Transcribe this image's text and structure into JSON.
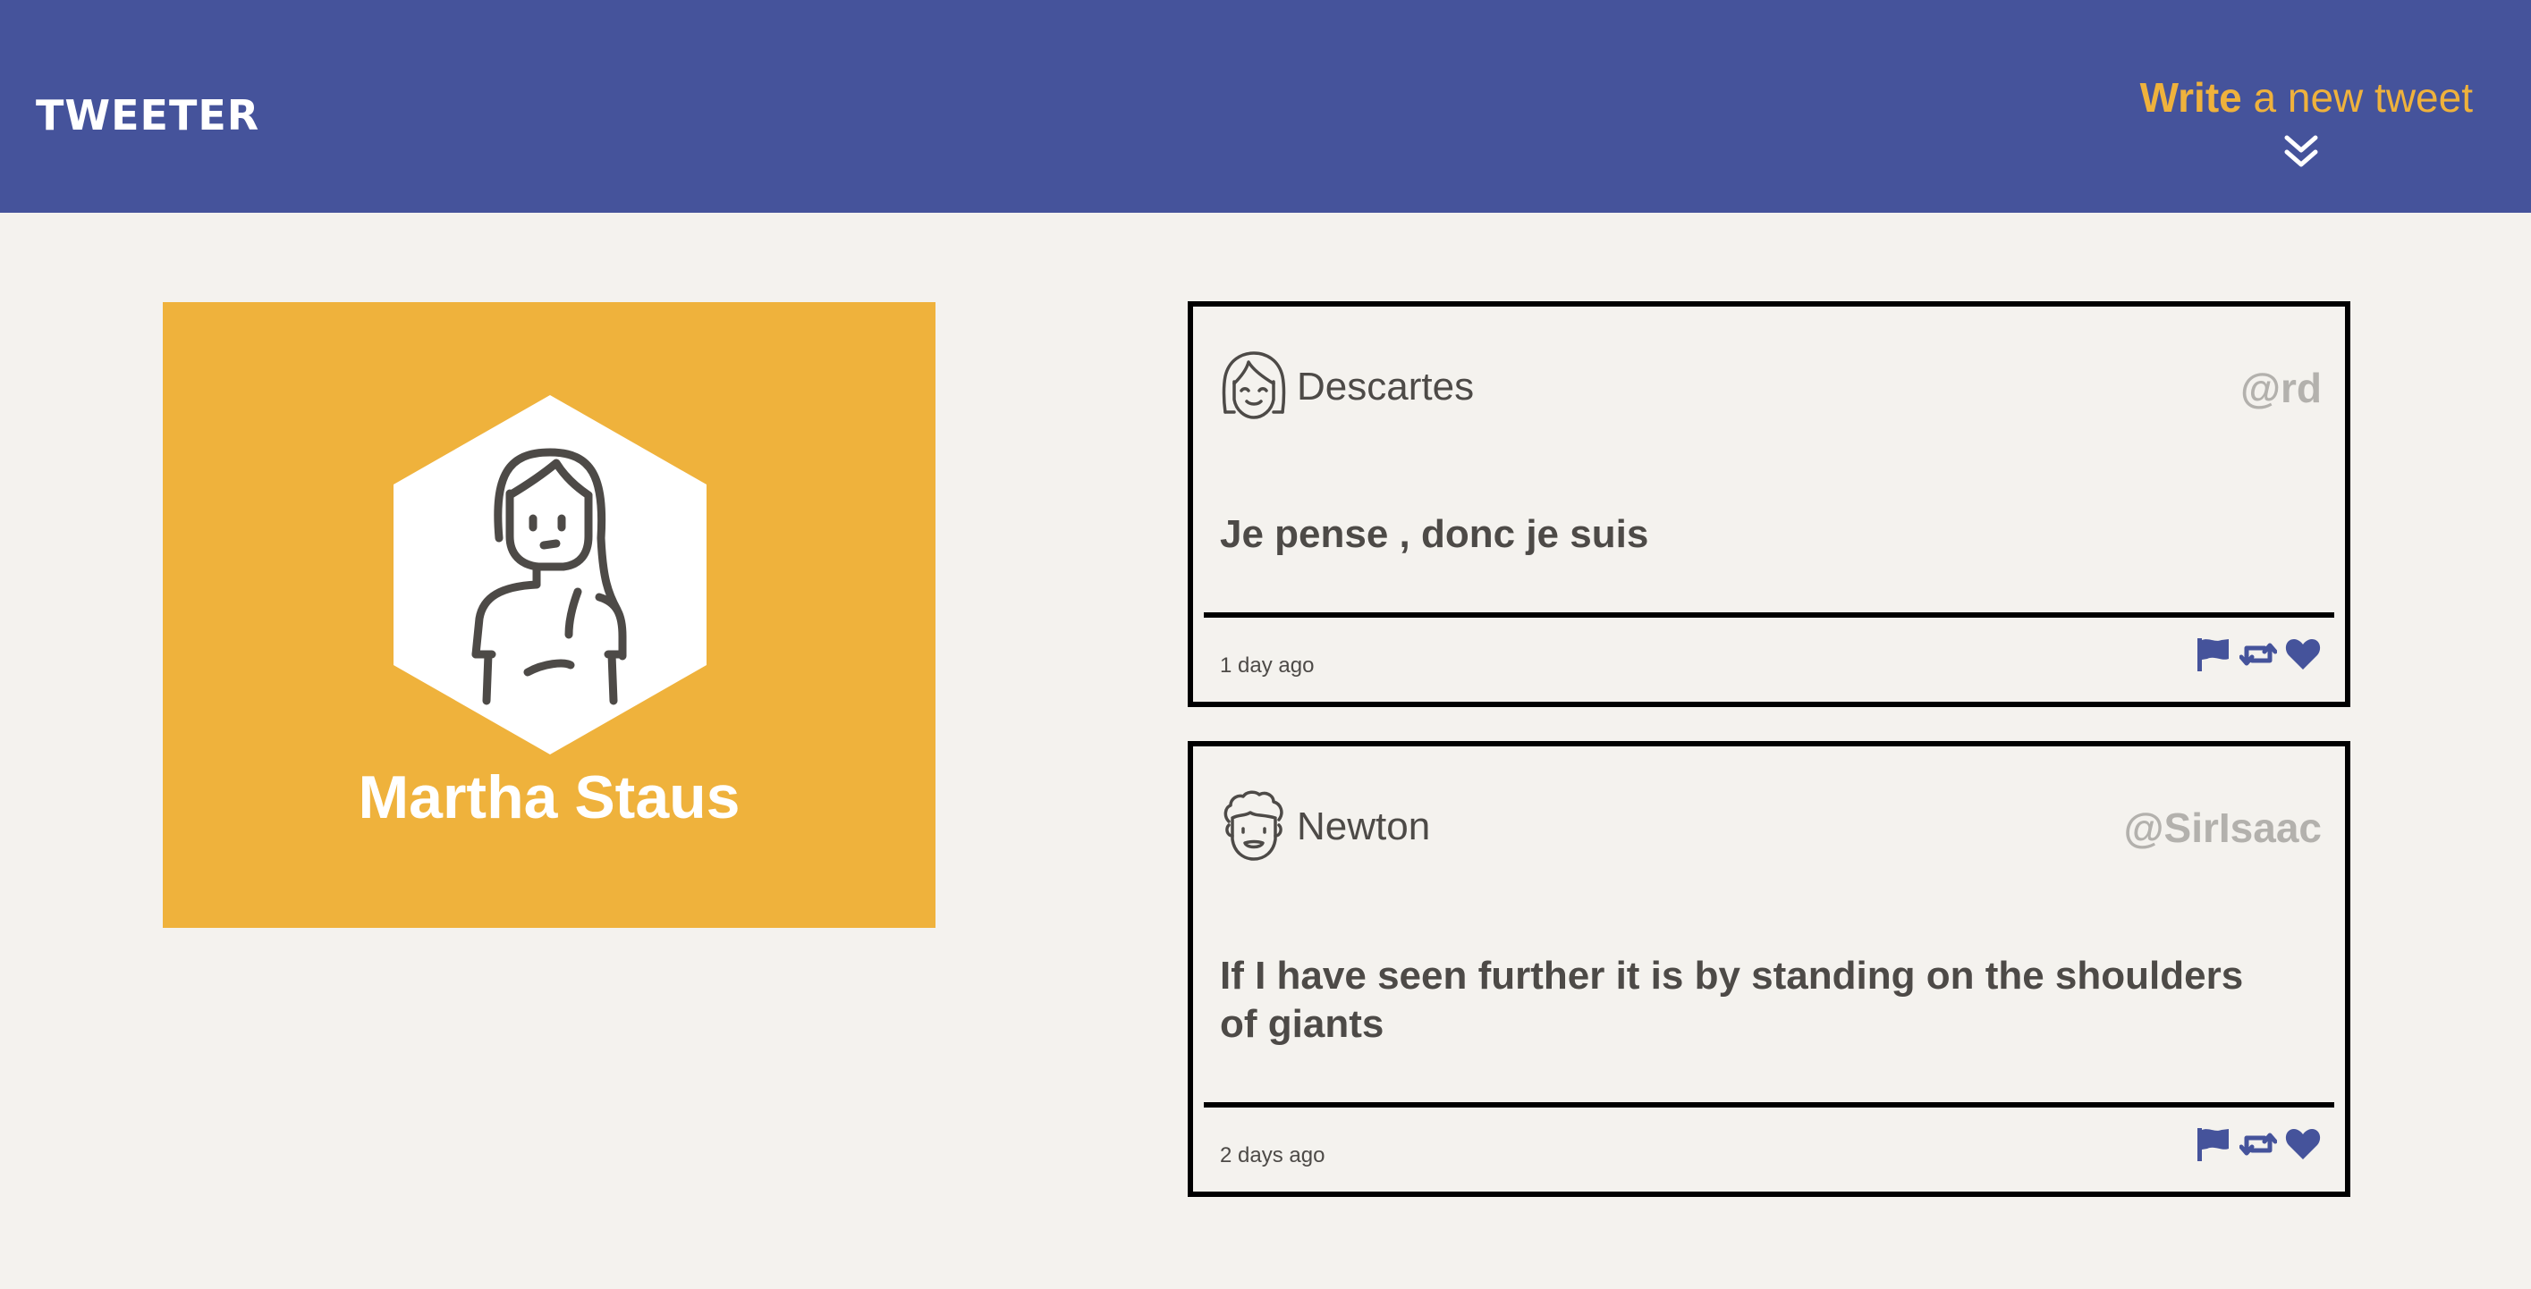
{
  "nav": {
    "brand": "TWEETER",
    "compose_bold": "Write",
    "compose_rest": " a new tweet",
    "compose_icon": "double-chevron-down-icon"
  },
  "profile": {
    "name": "Martha Staus",
    "avatar_icon": "woman-avatar-icon",
    "background": "#efb23c"
  },
  "tweets": [
    {
      "author": "Descartes",
      "handle": "@rd",
      "text": "Je pense , donc je suis",
      "time": "1 day ago",
      "avatar_icon": "smiling-girl-avatar-icon"
    },
    {
      "author": "Newton",
      "handle": "@SirIsaac",
      "text": "If I have seen further it is by standing on the shoulders of giants",
      "time": "2 days ago",
      "avatar_icon": "curly-hair-man-avatar-icon"
    }
  ],
  "actions": [
    "flag-icon",
    "retweet-icon",
    "heart-icon"
  ],
  "colors": {
    "nav": "#45539b",
    "accent": "#efb23c",
    "page": "#f4f2ee",
    "text": "#4d4a47",
    "handle": "#b3b1ad",
    "action": "#45539b"
  }
}
